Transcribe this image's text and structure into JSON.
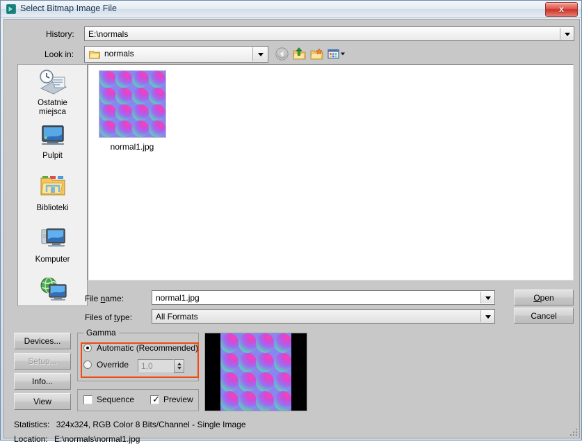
{
  "window": {
    "title": "Select Bitmap Image File",
    "title_icon": "app-arrow-icon",
    "close_label": "x"
  },
  "toolbar": {
    "history_label": "History:",
    "history_value": "E:\\normals",
    "lookin_label": "Look in:",
    "lookin_value": "normals",
    "icons": [
      {
        "name": "back-icon",
        "tip": "Back"
      },
      {
        "name": "up-folder-icon",
        "tip": "Up One Level"
      },
      {
        "name": "new-folder-icon",
        "tip": "Create New Folder"
      },
      {
        "name": "views-icon",
        "tip": "Views"
      }
    ]
  },
  "sidebar": {
    "items": [
      {
        "label_line1": "Ostatnie",
        "label_line2": "miejsca",
        "icon": "recent-places-icon"
      },
      {
        "label_line1": "Pulpit",
        "label_line2": "",
        "icon": "desktop-icon"
      },
      {
        "label_line1": "Biblioteki",
        "label_line2": "",
        "icon": "libraries-icon"
      },
      {
        "label_line1": "Komputer",
        "label_line2": "",
        "icon": "computer-icon"
      },
      {
        "label_line1": "",
        "label_line2": "",
        "icon": "network-icon"
      }
    ]
  },
  "filelist": {
    "files": [
      {
        "name": "normal1.jpg",
        "icon": "image-thumbnail"
      }
    ]
  },
  "fields": {
    "filename_label": "File name:",
    "filename_label_pre": "File ",
    "filename_label_mnemonic": "n",
    "filename_label_post": "ame:",
    "filename_value": "normal1.jpg",
    "filetype_label_pre": "Files of ",
    "filetype_label_mnemonic": "t",
    "filetype_label_post": "ype:",
    "filetype_value": "All Formats"
  },
  "buttons": {
    "open_pre": "",
    "open_mnemonic": "O",
    "open_post": "pen",
    "cancel": "Cancel",
    "devices": "Devices...",
    "setup": "Setup...",
    "info": "Info...",
    "view": "View"
  },
  "gamma": {
    "group_title": "Gamma",
    "automatic_label": "Automatic (Recommended)",
    "automatic_selected": true,
    "override_label": "Override",
    "override_selected": false,
    "override_value": "1,0",
    "highlight_color": "#f04a16"
  },
  "options": {
    "sequence_label": "Sequence",
    "sequence_checked": false,
    "preview_label": "Preview",
    "preview_checked": true,
    "check_glyph": "✓"
  },
  "status": {
    "statistics_label": "Statistics:",
    "statistics_value": "324x324, RGB Color 8 Bits/Channel - Single Image",
    "location_label": "Location:",
    "location_value": "E:\\normals\\normal1.jpg"
  }
}
